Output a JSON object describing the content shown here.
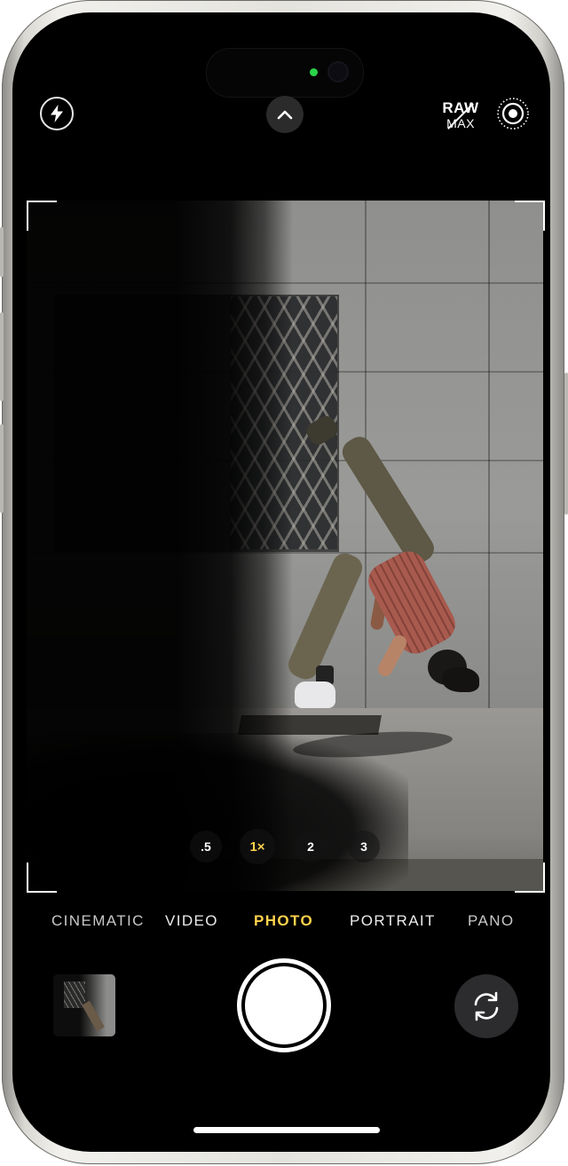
{
  "top_bar": {
    "flash_icon": "bolt-icon",
    "controls_icon": "chevron-up-icon",
    "raw_max": {
      "line1": "RAW",
      "line2": "MAX"
    },
    "live_photo_icon": "live-photo-icon"
  },
  "zoom": {
    "options": [
      {
        "label": ".5",
        "active": false
      },
      {
        "label": "1×",
        "active": true
      },
      {
        "label": "2",
        "active": false
      },
      {
        "label": "3",
        "active": false
      }
    ]
  },
  "modes": [
    {
      "label": "CINEMATIC",
      "active": false
    },
    {
      "label": "VIDEO",
      "active": false
    },
    {
      "label": "PHOTO",
      "active": true
    },
    {
      "label": "PORTRAIT",
      "active": false
    },
    {
      "label": "PANO",
      "active": false
    }
  ],
  "bottom_bar": {
    "thumbnail": "last-photo-thumbnail",
    "shutter": "shutter-button",
    "flip_icon": "camera-flip-icon"
  },
  "colors": {
    "accent_yellow": "#ffd34d",
    "background": "#000000",
    "frame": "#e4e3de"
  }
}
